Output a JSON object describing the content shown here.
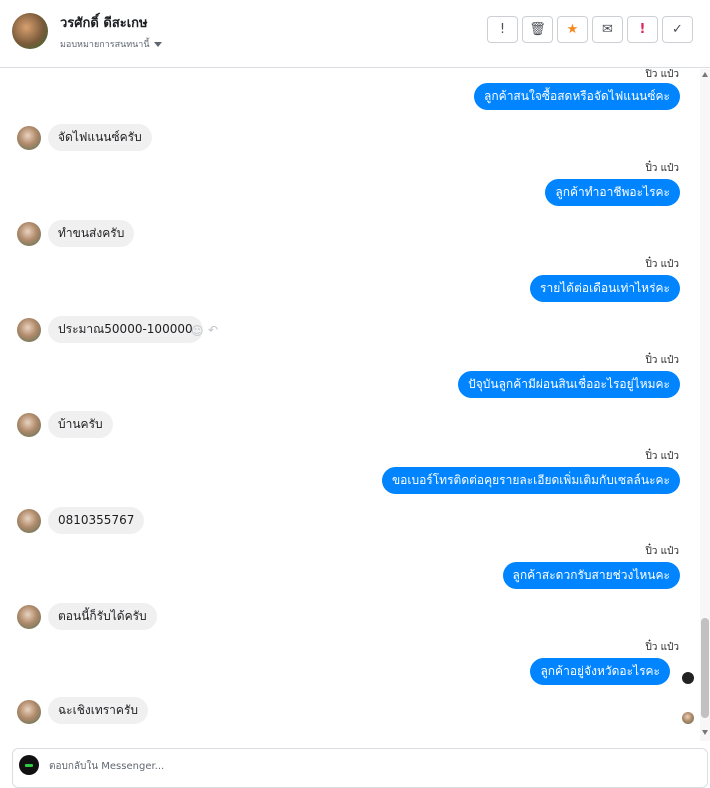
{
  "header": {
    "contact_name": "วรศักดิ์ ดีสะเกษ",
    "assign_label": "มอบหมายการสนทนานี้",
    "actions": [
      {
        "icon": "alert-circle-icon",
        "glyph": "!"
      },
      {
        "icon": "trash-icon",
        "glyph": "🗑"
      },
      {
        "icon": "star-icon",
        "glyph": "★"
      },
      {
        "icon": "mail-open-icon",
        "glyph": "✉"
      },
      {
        "icon": "important-icon",
        "glyph": "!"
      },
      {
        "icon": "check-icon",
        "glyph": "✓"
      }
    ]
  },
  "messages": [
    {
      "dir": "out",
      "sender": "ปิ๋ว แป๋ว",
      "text": "ลูกค้าสนใจซื้อสดหรือจัดไฟแนนซ์คะ"
    },
    {
      "dir": "in",
      "text": "จัดไฟแนนซ์ครับ"
    },
    {
      "dir": "out",
      "sender": "ปิ๋ว แป๋ว",
      "text": "ลูกค้าทำอาชีพอะไรคะ"
    },
    {
      "dir": "in",
      "text": "ทำขนส่งครับ"
    },
    {
      "dir": "out",
      "sender": "ปิ๋ว แป๋ว",
      "text": "รายได้ต่อเดือนเท่าไหร่คะ"
    },
    {
      "dir": "in",
      "text": "ประมาณ50000-100000"
    },
    {
      "dir": "out",
      "sender": "ปิ๋ว แป๋ว",
      "text": "ปัจุบันลูกค้ามีผ่อนสินเชื่ออะไรอยู่ไหมคะ"
    },
    {
      "dir": "in",
      "text": "บ้านครับ"
    },
    {
      "dir": "out",
      "sender": "ปิ๋ว แป๋ว",
      "text": "ขอเบอร์โทรติดต่อคุยรายละเอียดเพิ่มเติมกับเซลล์นะคะ"
    },
    {
      "dir": "in",
      "text": "0810355767"
    },
    {
      "dir": "out",
      "sender": "ปิ๋ว แป๋ว",
      "text": "ลูกค้าสะดวกรับสายช่วงไหนคะ"
    },
    {
      "dir": "in",
      "text": "ตอนนี้ก็รับได้ครับ"
    },
    {
      "dir": "out",
      "sender": "ปิ๋ว แป๋ว",
      "text": "ลูกค้าอยู่จังหวัดอะไรคะ"
    },
    {
      "dir": "in",
      "text": "ฉะเชิงเทราครับ"
    }
  ],
  "composer": {
    "placeholder": "ตอบกลับใน Messenger..."
  },
  "colors": {
    "outgoing_bubble": "#0084ff",
    "incoming_bubble": "#f1f0f0",
    "star": "#f5871f",
    "important": "#e0245e"
  }
}
